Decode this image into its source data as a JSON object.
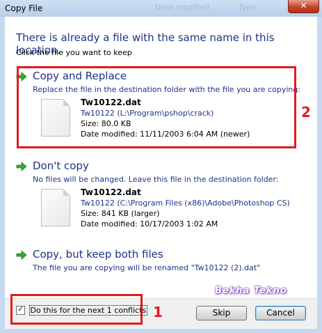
{
  "window": {
    "title": "Copy File",
    "ghost_left": "Date modified",
    "ghost_right": "Type",
    "close_glyph": "✕"
  },
  "header": {
    "heading": "There is already a file with the same name in this location.",
    "subheading": "Click the file you want to keep"
  },
  "options": [
    {
      "title": "Copy and Replace",
      "description": "Replace the file in the destination folder with the file you are copying:",
      "file": {
        "name": "Tw10122.dat",
        "path": "Tw10122 (L:\\Program\\pshop\\crack)",
        "size": "Size: 80.0 KB",
        "modified": "Date modified: 11/11/2003 6:04 AM (newer)"
      }
    },
    {
      "title": "Don't copy",
      "description": "No files will be changed. Leave this file in the destination folder:",
      "file": {
        "name": "Tw10122.dat",
        "path": "Tw10122 (C:\\Program Files (x86)\\Adobe\\Photoshop CS)",
        "size": "Size: 841 KB (larger)",
        "modified": "Date modified: 10/17/2003 1:02 AM"
      }
    },
    {
      "title": "Copy, but keep both files",
      "description": "The file you are copying will be renamed \"Tw10122 (2).dat\""
    }
  ],
  "footer": {
    "checkbox_label": "Do this for the next 1 conflicts",
    "checkbox_checked": true,
    "skip_label": "Skip",
    "cancel_label": "Cancel"
  },
  "annotations": {
    "mark_1": "1",
    "mark_2": "2",
    "watermark": "Bekha Tekno",
    "highlight_color": "#e11b1b"
  },
  "colors": {
    "link_blue": "#1e3287",
    "arrow_green": "#3aa636"
  },
  "icons": {
    "option_arrow": "green-arrow-icon",
    "file": "document-file-icon"
  }
}
